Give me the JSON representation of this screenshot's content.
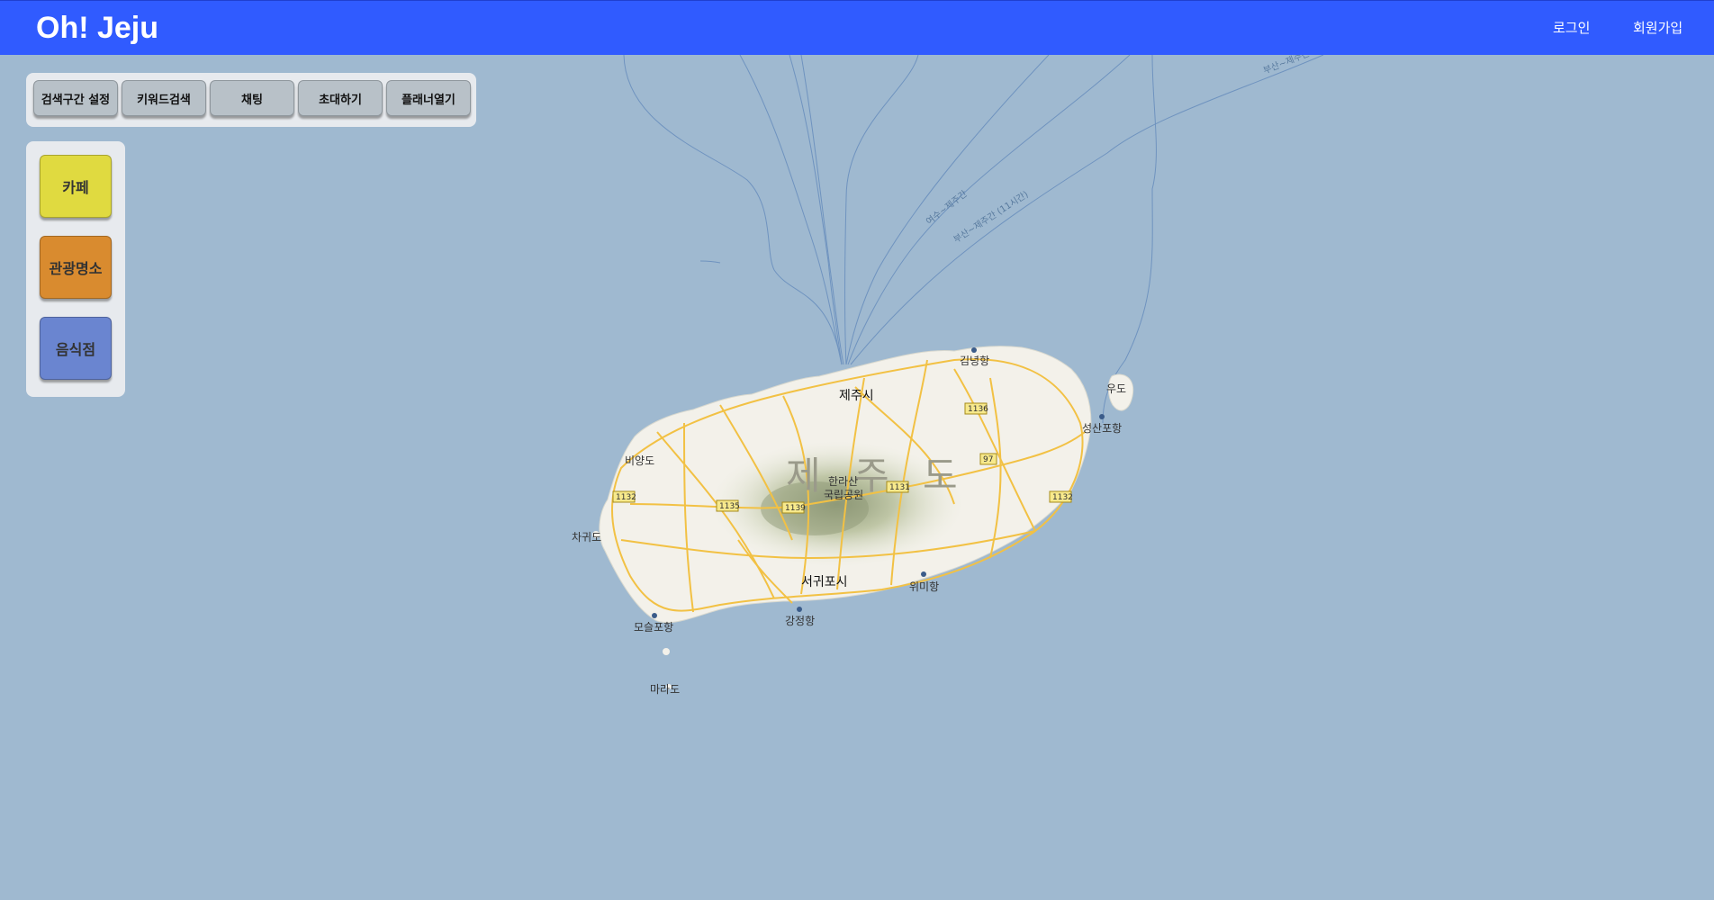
{
  "app": {
    "brand": "Oh! Jeju"
  },
  "nav": {
    "login": "로그인",
    "signup": "회원가입"
  },
  "toolbar": {
    "buttons": [
      "검색구간 설정",
      "키워드검색",
      "채팅",
      "초대하기",
      "플래너열기"
    ]
  },
  "categories": {
    "items": [
      {
        "label": "카페",
        "color": "#e0da40"
      },
      {
        "label": "관광명소",
        "color": "#d98b2f"
      },
      {
        "label": "음식점",
        "color": "#6a85d0"
      }
    ]
  },
  "map": {
    "island_label": "제 주 도",
    "cities": {
      "jeju": "제주시",
      "seogwipo": "서귀포시"
    },
    "park": [
      "한라산",
      "국립공원"
    ],
    "ports": {
      "gimnyeong": "김녕항",
      "seongsan": "성산포항",
      "wimi": "위미항",
      "gangjeong": "강정항",
      "moseulpo": "모슬포항"
    },
    "islands": {
      "udo": "우도",
      "biyangdo": "비양도",
      "chagwido": "차귀도",
      "marado": "마라도"
    },
    "roads": [
      "1136",
      "97",
      "1131",
      "1132",
      "1135",
      "1139",
      "1132"
    ],
    "ferry_routes": [
      "여수~제주간",
      "부산~제주간 (11시간)",
      "부산~제주간"
    ],
    "colors": {
      "sea": "#9fb9d0",
      "land": "#f3f1ea",
      "road": "#f2c144"
    }
  }
}
